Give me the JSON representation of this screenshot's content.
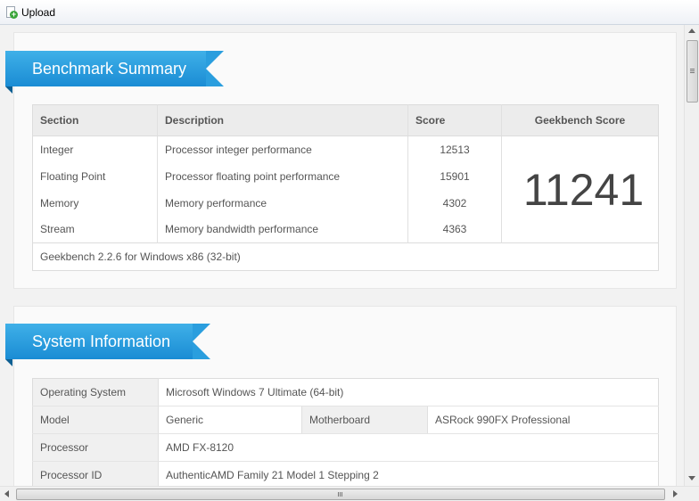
{
  "toolbar": {
    "upload_label": "Upload"
  },
  "benchmark": {
    "title": "Benchmark Summary",
    "headers": {
      "section": "Section",
      "description": "Description",
      "score": "Score",
      "geekbench_score": "Geekbench Score"
    },
    "rows": [
      {
        "section": "Integer",
        "description": "Processor integer performance",
        "score": "12513"
      },
      {
        "section": "Floating Point",
        "description": "Processor floating point performance",
        "score": "15901"
      },
      {
        "section": "Memory",
        "description": "Memory performance",
        "score": "4302"
      },
      {
        "section": "Stream",
        "description": "Memory bandwidth performance",
        "score": "4363"
      }
    ],
    "overall_score": "11241",
    "version": "Geekbench 2.2.6 for Windows x86 (32-bit)"
  },
  "system": {
    "title": "System Information",
    "os_label": "Operating System",
    "os_value": "Microsoft Windows 7 Ultimate (64-bit)",
    "model_label": "Model",
    "model_value": "Generic",
    "motherboard_label": "Motherboard",
    "motherboard_value": "ASRock 990FX Professional",
    "processor_label": "Processor",
    "processor_value": "AMD FX-8120",
    "processor_id_label": "Processor ID",
    "processor_id_value": "AuthenticAMD Family 21 Model 1 Stepping 2"
  }
}
